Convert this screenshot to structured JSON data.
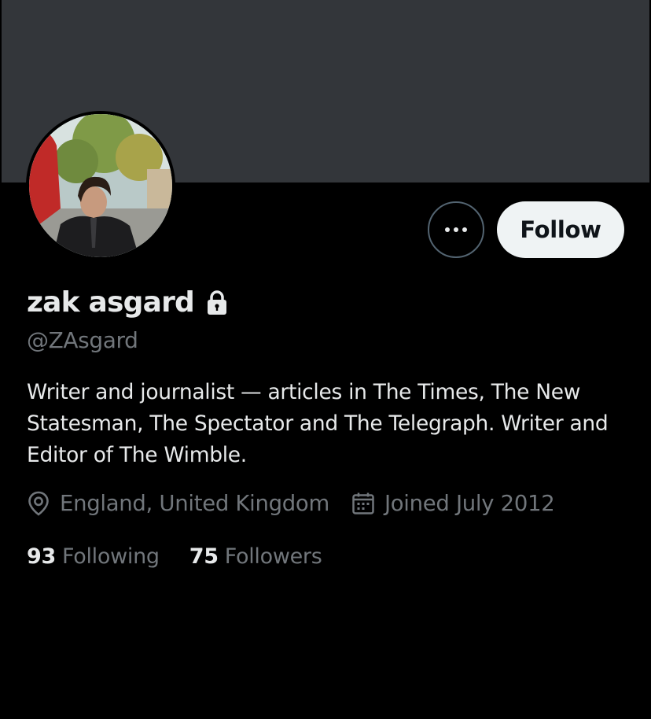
{
  "profile": {
    "display_name": "zak asgard",
    "handle": "@ZAsgard",
    "bio": "Writer and journalist — articles in The Times, The New Statesman, The Spectator and The Telegraph. Writer and Editor of The Wimble.",
    "location": "England, United Kingdom",
    "joined": "Joined July 2012",
    "protected": true
  },
  "actions": {
    "follow_label": "Follow",
    "more_icon": "more-horizontal-icon"
  },
  "stats": {
    "following_count": "93",
    "following_label": "Following",
    "followers_count": "75",
    "followers_label": "Followers"
  },
  "icons": {
    "lock": "lock-icon",
    "location": "location-pin-icon",
    "calendar": "calendar-icon"
  },
  "colors": {
    "background": "#000000",
    "banner": "#33363a",
    "primary_text": "#e7e9ea",
    "secondary_text": "#71767b",
    "button_bg": "#eff3f4",
    "button_text": "#0f1419",
    "outline": "#536471"
  }
}
